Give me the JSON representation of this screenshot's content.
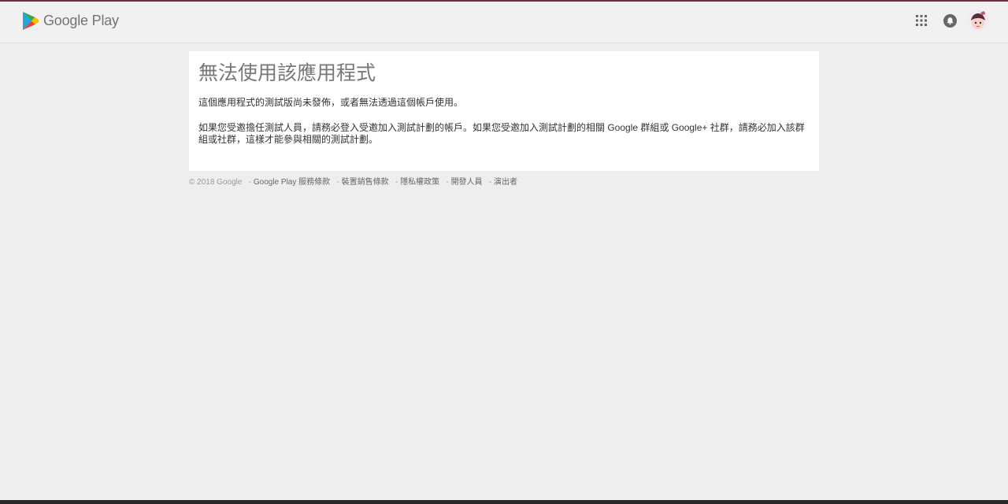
{
  "header": {
    "brand_text": "Google Play",
    "icons": [
      "google-play-logo",
      "apps-grid-icon",
      "notifications-icon",
      "user-avatar"
    ]
  },
  "error_card": {
    "title": "無法使用該應用程式",
    "message1": "這個應用程式的測試版尚未發佈，或者無法透過這個帳戶使用。",
    "message2": "如果您受邀擔任測試人員，請務必登入受邀加入測試計劃的帳戶。如果您受邀加入測試計劃的相關 Google 群組或 Google+ 社群，請務必加入該群組或社群，這樣才能參與相關的測試計劃。"
  },
  "footer": {
    "copyright": "© 2018 Google",
    "separator": "-",
    "links": [
      "Google Play 服務條款",
      "裝置銷售條款",
      "隱私權政策",
      "開發人員",
      "演出者"
    ]
  },
  "colors": {
    "accent_top": "#7b2a3c",
    "page_bg": "#eeeeee",
    "header_bg": "#f1f1f1",
    "card_bg": "#ffffff",
    "title_text": "#777777",
    "body_text": "#333333",
    "footer_text": "#999999"
  }
}
